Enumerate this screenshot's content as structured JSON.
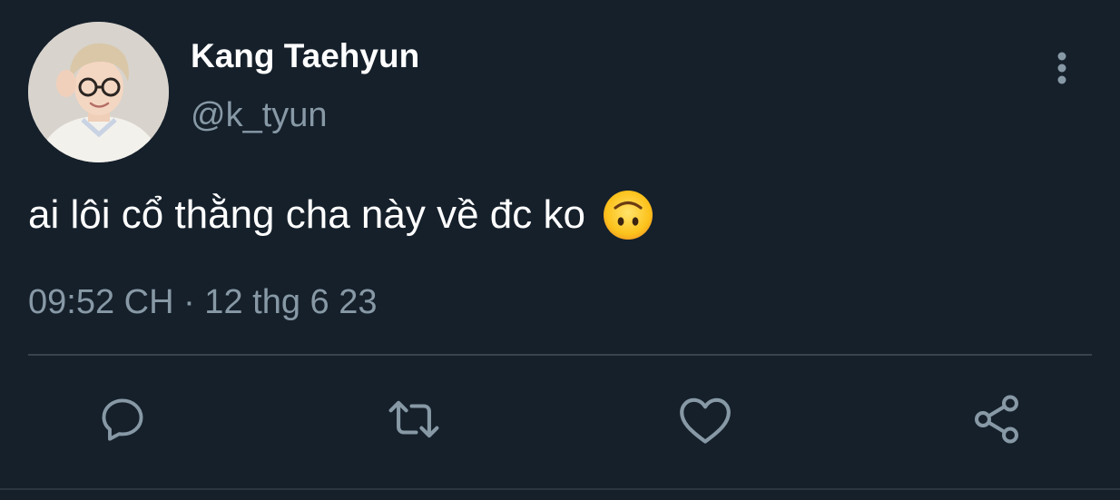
{
  "tweet": {
    "display_name": "Kang Taehyun",
    "handle": "@k_tyun",
    "text": "ai lôi cổ thằng cha này về đc ko",
    "emoji": "upside-down-face-emoji",
    "timestamp": "09:52 CH · 12 thg 6 23"
  },
  "icons": {
    "more": "more-vertical-icon",
    "reply": "reply-icon",
    "retweet": "retweet-icon",
    "like": "heart-icon",
    "share": "share-icon"
  },
  "colors": {
    "background": "#15202b",
    "text_primary": "#ffffff",
    "text_secondary": "#8899a6",
    "icon": "#8899a6",
    "divider": "#38444d"
  }
}
